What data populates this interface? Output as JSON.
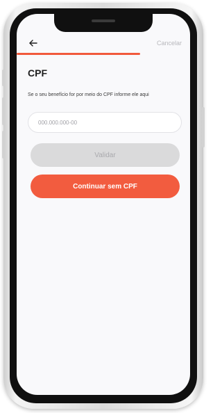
{
  "header": {
    "back_icon": "arrow-left-icon",
    "cancel_label": "Cancelar"
  },
  "progress": {
    "fraction": 0.71,
    "color": "#f15a3c"
  },
  "page": {
    "title": "CPF",
    "subtitle": "Se o seu benefício for por meio do CPF informe ele aqui"
  },
  "cpf_field": {
    "placeholder": "000.000.000-00",
    "value": ""
  },
  "buttons": {
    "validate_label": "Validar",
    "continue_label": "Continuar sem CPF"
  },
  "colors": {
    "accent": "#f25c3f",
    "disabled_bg": "#dadadb",
    "disabled_text": "#a9a9ad"
  }
}
